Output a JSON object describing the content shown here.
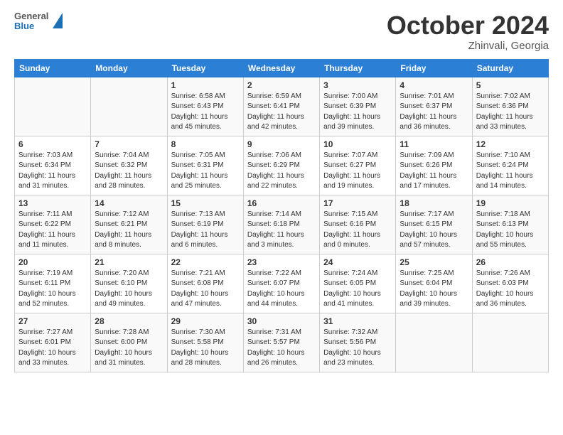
{
  "header": {
    "logo_line1": "General",
    "logo_line2": "Blue",
    "title": "October 2024",
    "subtitle": "Zhinvali, Georgia"
  },
  "calendar": {
    "weekdays": [
      "Sunday",
      "Monday",
      "Tuesday",
      "Wednesday",
      "Thursday",
      "Friday",
      "Saturday"
    ],
    "weeks": [
      [
        {
          "day": "",
          "sunrise": "",
          "sunset": "",
          "daylight": ""
        },
        {
          "day": "",
          "sunrise": "",
          "sunset": "",
          "daylight": ""
        },
        {
          "day": "1",
          "sunrise": "Sunrise: 6:58 AM",
          "sunset": "Sunset: 6:43 PM",
          "daylight": "Daylight: 11 hours and 45 minutes."
        },
        {
          "day": "2",
          "sunrise": "Sunrise: 6:59 AM",
          "sunset": "Sunset: 6:41 PM",
          "daylight": "Daylight: 11 hours and 42 minutes."
        },
        {
          "day": "3",
          "sunrise": "Sunrise: 7:00 AM",
          "sunset": "Sunset: 6:39 PM",
          "daylight": "Daylight: 11 hours and 39 minutes."
        },
        {
          "day": "4",
          "sunrise": "Sunrise: 7:01 AM",
          "sunset": "Sunset: 6:37 PM",
          "daylight": "Daylight: 11 hours and 36 minutes."
        },
        {
          "day": "5",
          "sunrise": "Sunrise: 7:02 AM",
          "sunset": "Sunset: 6:36 PM",
          "daylight": "Daylight: 11 hours and 33 minutes."
        }
      ],
      [
        {
          "day": "6",
          "sunrise": "Sunrise: 7:03 AM",
          "sunset": "Sunset: 6:34 PM",
          "daylight": "Daylight: 11 hours and 31 minutes."
        },
        {
          "day": "7",
          "sunrise": "Sunrise: 7:04 AM",
          "sunset": "Sunset: 6:32 PM",
          "daylight": "Daylight: 11 hours and 28 minutes."
        },
        {
          "day": "8",
          "sunrise": "Sunrise: 7:05 AM",
          "sunset": "Sunset: 6:31 PM",
          "daylight": "Daylight: 11 hours and 25 minutes."
        },
        {
          "day": "9",
          "sunrise": "Sunrise: 7:06 AM",
          "sunset": "Sunset: 6:29 PM",
          "daylight": "Daylight: 11 hours and 22 minutes."
        },
        {
          "day": "10",
          "sunrise": "Sunrise: 7:07 AM",
          "sunset": "Sunset: 6:27 PM",
          "daylight": "Daylight: 11 hours and 19 minutes."
        },
        {
          "day": "11",
          "sunrise": "Sunrise: 7:09 AM",
          "sunset": "Sunset: 6:26 PM",
          "daylight": "Daylight: 11 hours and 17 minutes."
        },
        {
          "day": "12",
          "sunrise": "Sunrise: 7:10 AM",
          "sunset": "Sunset: 6:24 PM",
          "daylight": "Daylight: 11 hours and 14 minutes."
        }
      ],
      [
        {
          "day": "13",
          "sunrise": "Sunrise: 7:11 AM",
          "sunset": "Sunset: 6:22 PM",
          "daylight": "Daylight: 11 hours and 11 minutes."
        },
        {
          "day": "14",
          "sunrise": "Sunrise: 7:12 AM",
          "sunset": "Sunset: 6:21 PM",
          "daylight": "Daylight: 11 hours and 8 minutes."
        },
        {
          "day": "15",
          "sunrise": "Sunrise: 7:13 AM",
          "sunset": "Sunset: 6:19 PM",
          "daylight": "Daylight: 11 hours and 6 minutes."
        },
        {
          "day": "16",
          "sunrise": "Sunrise: 7:14 AM",
          "sunset": "Sunset: 6:18 PM",
          "daylight": "Daylight: 11 hours and 3 minutes."
        },
        {
          "day": "17",
          "sunrise": "Sunrise: 7:15 AM",
          "sunset": "Sunset: 6:16 PM",
          "daylight": "Daylight: 11 hours and 0 minutes."
        },
        {
          "day": "18",
          "sunrise": "Sunrise: 7:17 AM",
          "sunset": "Sunset: 6:15 PM",
          "daylight": "Daylight: 10 hours and 57 minutes."
        },
        {
          "day": "19",
          "sunrise": "Sunrise: 7:18 AM",
          "sunset": "Sunset: 6:13 PM",
          "daylight": "Daylight: 10 hours and 55 minutes."
        }
      ],
      [
        {
          "day": "20",
          "sunrise": "Sunrise: 7:19 AM",
          "sunset": "Sunset: 6:11 PM",
          "daylight": "Daylight: 10 hours and 52 minutes."
        },
        {
          "day": "21",
          "sunrise": "Sunrise: 7:20 AM",
          "sunset": "Sunset: 6:10 PM",
          "daylight": "Daylight: 10 hours and 49 minutes."
        },
        {
          "day": "22",
          "sunrise": "Sunrise: 7:21 AM",
          "sunset": "Sunset: 6:08 PM",
          "daylight": "Daylight: 10 hours and 47 minutes."
        },
        {
          "day": "23",
          "sunrise": "Sunrise: 7:22 AM",
          "sunset": "Sunset: 6:07 PM",
          "daylight": "Daylight: 10 hours and 44 minutes."
        },
        {
          "day": "24",
          "sunrise": "Sunrise: 7:24 AM",
          "sunset": "Sunset: 6:05 PM",
          "daylight": "Daylight: 10 hours and 41 minutes."
        },
        {
          "day": "25",
          "sunrise": "Sunrise: 7:25 AM",
          "sunset": "Sunset: 6:04 PM",
          "daylight": "Daylight: 10 hours and 39 minutes."
        },
        {
          "day": "26",
          "sunrise": "Sunrise: 7:26 AM",
          "sunset": "Sunset: 6:03 PM",
          "daylight": "Daylight: 10 hours and 36 minutes."
        }
      ],
      [
        {
          "day": "27",
          "sunrise": "Sunrise: 7:27 AM",
          "sunset": "Sunset: 6:01 PM",
          "daylight": "Daylight: 10 hours and 33 minutes."
        },
        {
          "day": "28",
          "sunrise": "Sunrise: 7:28 AM",
          "sunset": "Sunset: 6:00 PM",
          "daylight": "Daylight: 10 hours and 31 minutes."
        },
        {
          "day": "29",
          "sunrise": "Sunrise: 7:30 AM",
          "sunset": "Sunset: 5:58 PM",
          "daylight": "Daylight: 10 hours and 28 minutes."
        },
        {
          "day": "30",
          "sunrise": "Sunrise: 7:31 AM",
          "sunset": "Sunset: 5:57 PM",
          "daylight": "Daylight: 10 hours and 26 minutes."
        },
        {
          "day": "31",
          "sunrise": "Sunrise: 7:32 AM",
          "sunset": "Sunset: 5:56 PM",
          "daylight": "Daylight: 10 hours and 23 minutes."
        },
        {
          "day": "",
          "sunrise": "",
          "sunset": "",
          "daylight": ""
        },
        {
          "day": "",
          "sunrise": "",
          "sunset": "",
          "daylight": ""
        }
      ]
    ]
  }
}
